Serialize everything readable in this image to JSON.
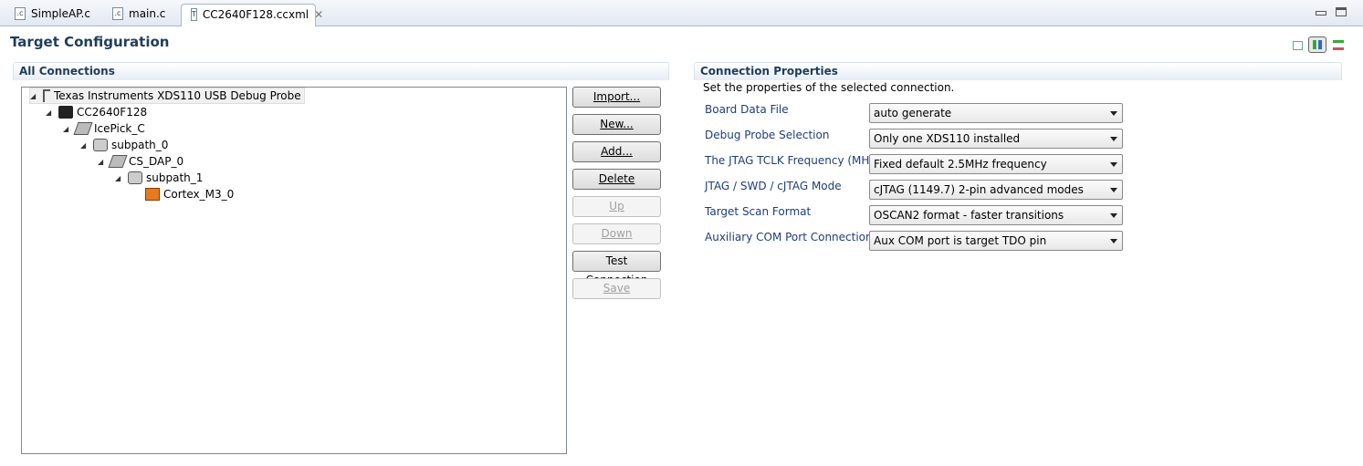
{
  "tabs": [
    {
      "label": "SimpleAP.c",
      "icon": "c-file-icon"
    },
    {
      "label": "main.c",
      "icon": "c-file-icon"
    },
    {
      "label": "CC2640F128.ccxml",
      "icon": "target-config-icon",
      "active": true
    }
  ],
  "title": "Target Configuration",
  "left": {
    "header": "All Connections",
    "tree": [
      "Texas Instruments XDS110 USB Debug Probe",
      "CC2640F128",
      "IcePick_C",
      "subpath_0",
      "CS_DAP_0",
      "subpath_1",
      "Cortex_M3_0"
    ],
    "buttons": [
      "Import...",
      "New...",
      "Add...",
      "Delete",
      "Up",
      "Down",
      "Test Connection",
      "Save"
    ]
  },
  "right": {
    "header": "Connection Properties",
    "subtitle": "Set the properties of the selected connection.",
    "properties": [
      {
        "label": "Board Data File",
        "value": "auto generate"
      },
      {
        "label": "Debug Probe Selection",
        "value": "Only one XDS110 installed"
      },
      {
        "label": "The JTAG TCLK Frequency (MHz)",
        "value": "Fixed default 2.5MHz frequency"
      },
      {
        "label": "JTAG / SWD / cJTAG Mode",
        "value": "cJTAG (1149.7) 2-pin advanced modes"
      },
      {
        "label": "Target Scan Format",
        "value": "OSCAN2 format - faster transitions"
      },
      {
        "label": "Auxiliary COM Port Connection",
        "value": "Aux COM port is target TDO pin"
      }
    ]
  }
}
